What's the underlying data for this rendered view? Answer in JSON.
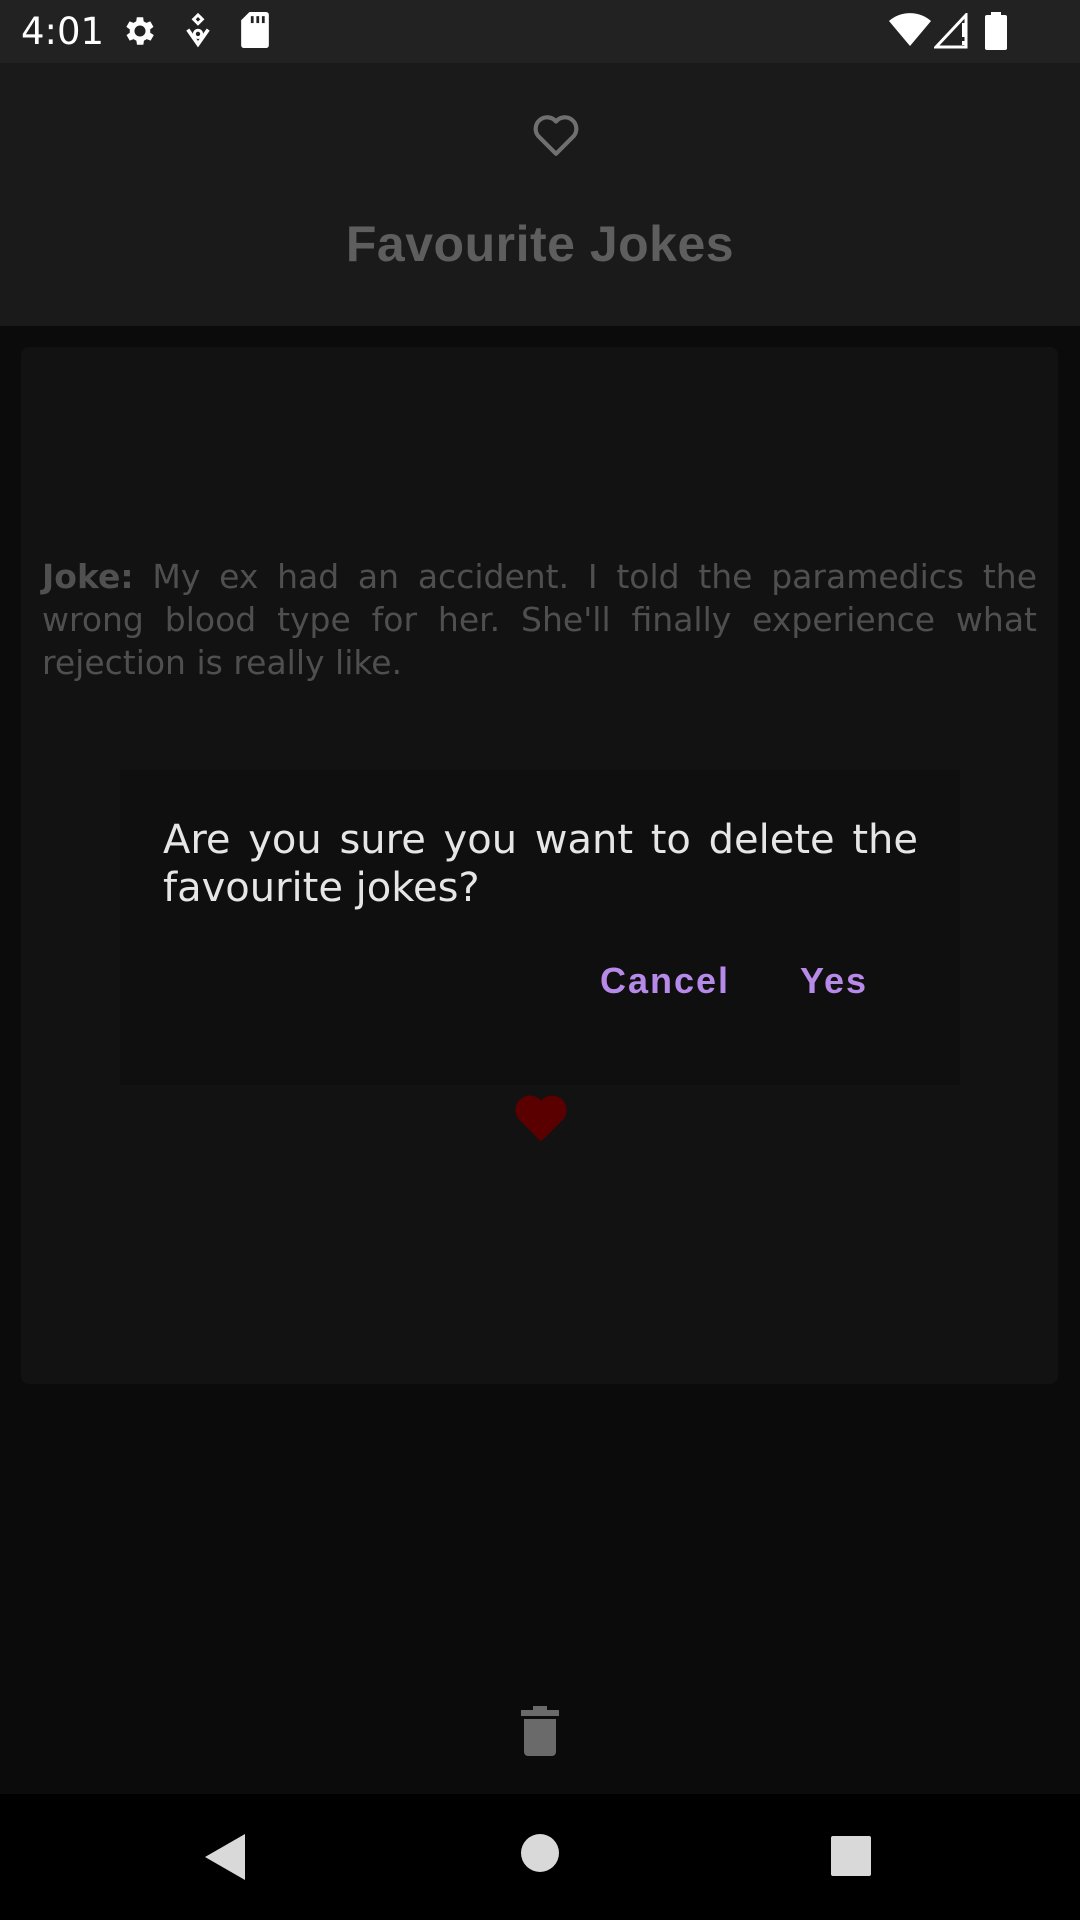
{
  "status_bar": {
    "time": "4:01",
    "icons": [
      "settings-gear-icon",
      "location-pin-icon",
      "sd-card-icon",
      "wifi-icon",
      "cell-signal-icon",
      "battery-icon"
    ]
  },
  "header": {
    "icon": "heart-outline-icon",
    "title": "Favourite Jokes"
  },
  "card": {
    "joke_label": "Joke:",
    "joke_text": " My ex had an accident. I told the paramedics the wrong blood type for her. She'll finally experience what rejection is really like.",
    "favorite_icon": "heart-filled-icon"
  },
  "dialog": {
    "message": "Are you sure you want to delete the favourite jokes?",
    "cancel_label": "Cancel",
    "yes_label": "Yes"
  },
  "footer": {
    "delete_icon": "trash-icon"
  },
  "nav": {
    "icons": [
      "back-icon",
      "home-icon",
      "recents-icon"
    ]
  },
  "colors": {
    "accent": "#b789e8",
    "heart": "#5a0000"
  }
}
